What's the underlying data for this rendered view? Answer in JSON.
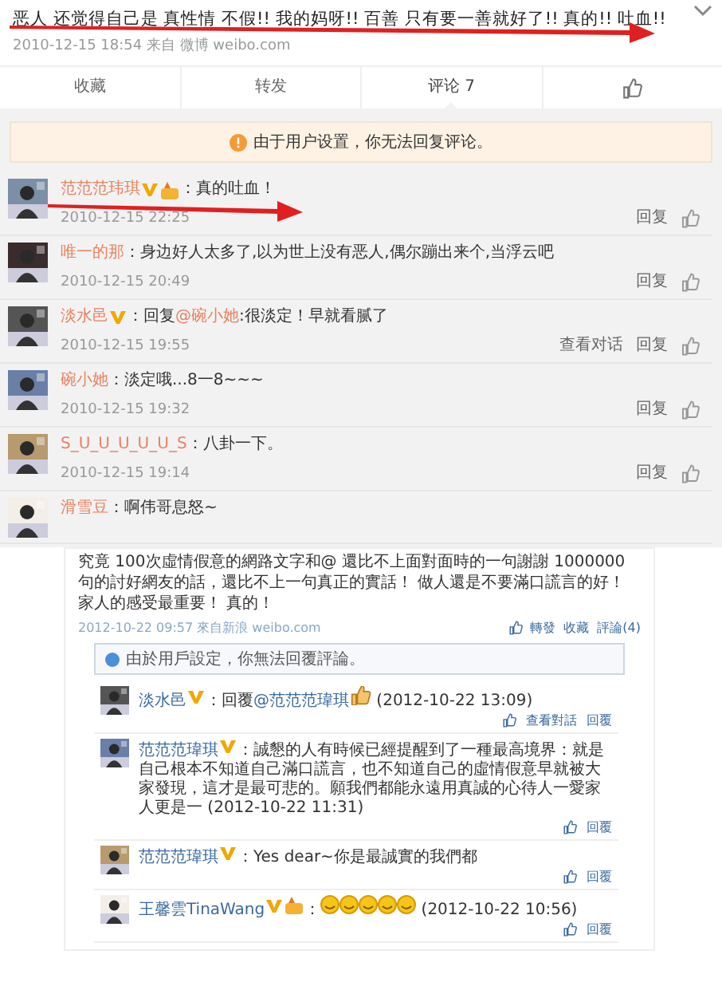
{
  "top_post": {
    "text": "恶人 还觉得自己是 真性情 不假!! 我的妈呀!! 百善 只有要一善就好了!! 真的!! 吐血!!",
    "meta": "2010-12-15 18:54 来自 微博 weibo.com",
    "tabs": [
      {
        "label": "收藏",
        "selected": false
      },
      {
        "label": "转发",
        "selected": false
      },
      {
        "label": "评论 7",
        "selected": true
      }
    ],
    "notice": "由于用户设置，你无法回复评论。",
    "comments": [
      {
        "name": "范范范玮琪",
        "verified": true,
        "badge": true,
        "arrow": true,
        "segments": [
          {
            "kind": "plain",
            "text": "：真的吐血！"
          }
        ],
        "time": "2010-12-15 22:25",
        "actions": [
          "回复"
        ]
      },
      {
        "name": "唯一的那",
        "verified": false,
        "badge": false,
        "arrow": false,
        "segments": [
          {
            "kind": "plain",
            "text": "：身边好人太多了,以为世上没有恶人,偶尔蹦出来个,当浮云吧"
          }
        ],
        "time": "2010-12-15 20:49",
        "actions": [
          "回复"
        ]
      },
      {
        "name": "淡水邑",
        "verified": true,
        "badge": false,
        "arrow": false,
        "segments": [
          {
            "kind": "plain",
            "text": "：回复 "
          },
          {
            "kind": "mention",
            "text": "@碗小她"
          },
          {
            "kind": "plain",
            "text": ":很淡定！早就看腻了"
          }
        ],
        "time": "2010-12-15 19:55",
        "actions": [
          "查看对话",
          "回复"
        ]
      },
      {
        "name": "碗小她",
        "verified": false,
        "badge": false,
        "arrow": false,
        "segments": [
          {
            "kind": "plain",
            "text": "：淡定哦...8一8~~~"
          }
        ],
        "time": "2010-12-15 19:32",
        "actions": [
          "回复"
        ]
      },
      {
        "name": "S_U_U_U_U_U_S",
        "verified": false,
        "badge": false,
        "arrow": false,
        "segments": [
          {
            "kind": "plain",
            "text": "：八卦一下。"
          }
        ],
        "time": "2010-12-15 19:14",
        "actions": [
          "回复"
        ]
      },
      {
        "name": "滑雪豆",
        "verified": false,
        "badge": false,
        "arrow": false,
        "segments": [
          {
            "kind": "plain",
            "text": "：啊伟哥息怒~"
          }
        ]
      }
    ]
  },
  "bottom_post": {
    "text": "究竟 100次虛情假意的網路文字和@ 還比不上面對面時的一句謝謝 1000000句的討好網友的話，還比不上一句真正的實話！ 做人還是不要滿口謊言的好！家人的感受最重要！ 真的！",
    "meta": "2012-10-22 09:57 來自新浪 weibo.com",
    "actions": [
      "轉發",
      "收藏",
      "評論(4)"
    ],
    "notice": "由於用戶設定，你無法回覆評論。",
    "comments": [
      {
        "name": "淡水邑",
        "verified": true,
        "badge": false,
        "segments": [
          {
            "kind": "plain",
            "text": "：回覆"
          },
          {
            "kind": "mention",
            "text": "@范范范瑋琪"
          },
          {
            "kind": "sticker"
          },
          {
            "kind": "plain",
            "text": " (2012-10-22 13:09)"
          }
        ],
        "actions": [
          "查看對話",
          "回覆"
        ]
      },
      {
        "name": "范范范瑋琪",
        "verified": true,
        "badge": false,
        "segments": [
          {
            "kind": "plain",
            "text": "：誠懇的人有時候已經提醒到了一種最高境界：就是自己根本不知道自己滿口謊言，也不知道自己的虛情假意早就被大家發現，這才是最可悲的。願我們都能永遠用真誠的心待人一愛家人更是一 (2012-10-22 11:31)"
          }
        ],
        "actions": [
          "回覆"
        ]
      },
      {
        "name": "范范范瑋琪",
        "verified": true,
        "badge": false,
        "segments": [
          {
            "kind": "plain",
            "text": "：Yes dear~你是最誠實的我們都"
          }
        ],
        "actions": [
          "回覆"
        ]
      },
      {
        "name": "王馨雲TinaWang",
        "verified": true,
        "badge": true,
        "segments": [
          {
            "kind": "plain",
            "text": "："
          },
          {
            "kind": "emoji"
          },
          {
            "kind": "emoji"
          },
          {
            "kind": "emoji"
          },
          {
            "kind": "emoji"
          },
          {
            "kind": "emoji"
          },
          {
            "kind": "plain",
            "text": " (2012-10-22 10:56)"
          }
        ],
        "actions": [
          "回覆"
        ]
      }
    ]
  }
}
